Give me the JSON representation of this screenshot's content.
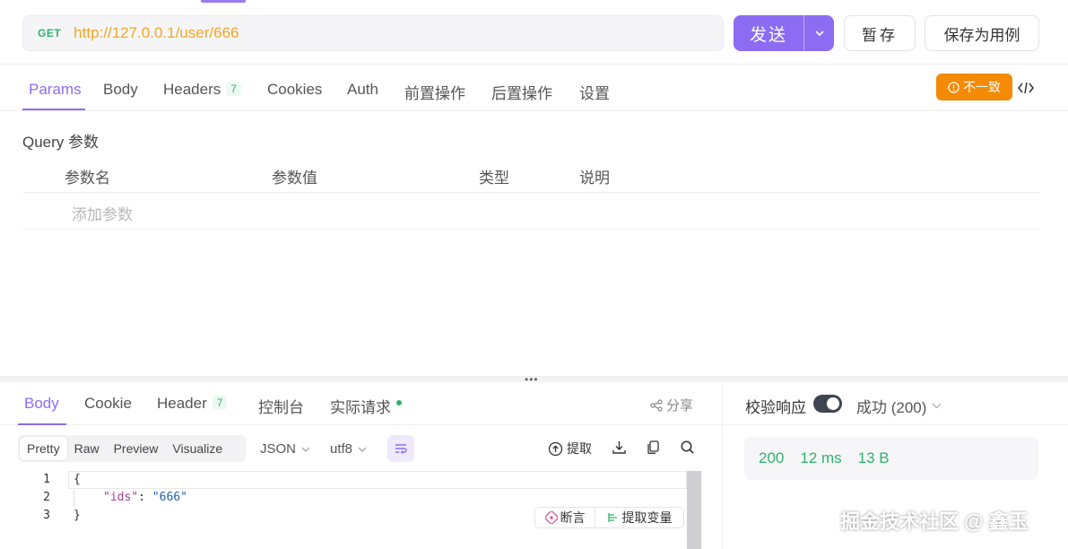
{
  "request": {
    "method": "GET",
    "url": "http://127.0.0.1/user/666",
    "send_label": "发送",
    "save_label": "暂存",
    "save_case_label": "保存为用例"
  },
  "req_tabs": {
    "params": "Params",
    "body": "Body",
    "headers": "Headers",
    "headers_count": "7",
    "cookies": "Cookies",
    "auth": "Auth",
    "pre_ops": "前置操作",
    "post_ops": "后置操作",
    "settings": "设置",
    "mismatch_badge": "不一致"
  },
  "query": {
    "title": "Query 参数",
    "columns": [
      "参数名",
      "参数值",
      "类型",
      "说明"
    ],
    "add_placeholder": "添加参数"
  },
  "response": {
    "tabs": {
      "body": "Body",
      "cookie": "Cookie",
      "header": "Header",
      "header_count": "7",
      "console": "控制台",
      "actual_request": "实际请求"
    },
    "share": "分享",
    "view_modes": [
      "Pretty",
      "Raw",
      "Preview",
      "Visualize"
    ],
    "format": "JSON",
    "encoding": "utf8",
    "extract": "提取",
    "code_lines": [
      "1",
      "2",
      "3"
    ],
    "code": {
      "open": "{",
      "key": "\"ids\"",
      "colon": ": ",
      "value": "\"666\"",
      "close": "}"
    },
    "assert_label": "断言",
    "extract_var_label": "提取变量"
  },
  "validation": {
    "label": "校验响应",
    "toggle_on": true,
    "status": "成功 (200)",
    "status_code": "200",
    "time": "12 ms",
    "size": "13 B"
  },
  "watermark": "掘金技术社区 @ 鑫玉",
  "colors": {
    "accent": "#8c6cf2",
    "method_get": "#2fb36f",
    "url": "#f5a623",
    "warning": "#f48a06",
    "success": "#2fb36f"
  }
}
